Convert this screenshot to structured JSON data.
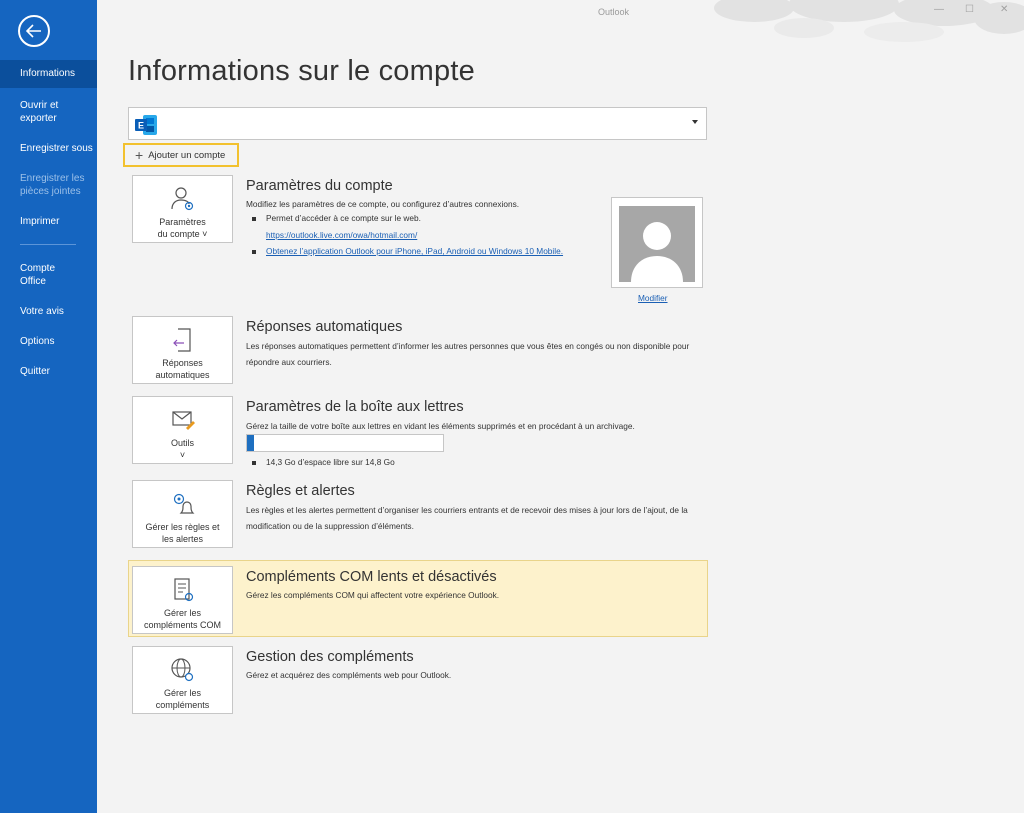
{
  "window": {
    "app_name": "Outlook"
  },
  "sidebar": {
    "items": [
      {
        "label": "Informations",
        "active": true
      },
      {
        "label": "Ouvrir et\nexporter"
      },
      {
        "label": "Enregistrer sous"
      },
      {
        "label": "Enregistrer les\npièces jointes",
        "disabled": true
      },
      {
        "label": "Imprimer"
      },
      {
        "label": "Compte\nOffice"
      },
      {
        "label": "Votre avis"
      },
      {
        "label": "Options"
      },
      {
        "label": "Quitter"
      }
    ]
  },
  "page": {
    "title": "Informations sur le compte"
  },
  "account": {
    "add_label": "Ajouter un compte"
  },
  "sections": {
    "account_settings": {
      "tile_label": "Paramètres\ndu compte ˅",
      "title": "Paramètres du compte",
      "desc": "Modifiez les paramètres de ce compte, ou configurez d’autres connexions.",
      "bullet1": "Permet d’accéder à ce compte sur le web.",
      "link1": "https://outlook.live.com/owa/hotmail.com/",
      "link2": "Obtenez l’application Outlook pour iPhone, iPad, Android ou Windows 10 Mobile.",
      "photo_link": "Modifier"
    },
    "auto_replies": {
      "tile_label": "Réponses\nautomatiques",
      "title": "Réponses automatiques",
      "desc": "Les réponses automatiques permettent d’informer les autres personnes que vous êtes en congés ou non disponible pour répondre aux courriers."
    },
    "mailbox": {
      "tile_label": "Outils\n˅",
      "title": "Paramètres de la boîte aux lettres",
      "desc": "Gérez la taille de votre boîte aux lettres en vidant les éléments supprimés et en procédant à un archivage.",
      "quota_text": "14,3 Go d’espace libre sur 14,8 Go",
      "used_fraction": 0.034
    },
    "rules": {
      "tile_label": "Gérer les règles et\nles alertes",
      "title": "Règles et alertes",
      "desc": "Les règles et les alertes permettent d’organiser les courriers entrants et de recevoir des mises à jour lors de l’ajout, de la modification ou de la suppression d’éléments."
    },
    "com_addins": {
      "tile_label": "Gérer les\ncompléments COM",
      "title": "Compléments COM lents et désactivés",
      "desc": "Gérez les compléments COM qui affectent votre expérience Outlook."
    },
    "addins": {
      "tile_label": "Gérer les\ncompléments",
      "title": "Gestion des compléments",
      "desc": "Gérez et acquérez des compléments web pour Outlook."
    }
  },
  "colors": {
    "sidebar": "#1565c0",
    "highlight": "#f2c12e",
    "com_panel": "#fdf2cc",
    "link": "#1a5fb4"
  }
}
